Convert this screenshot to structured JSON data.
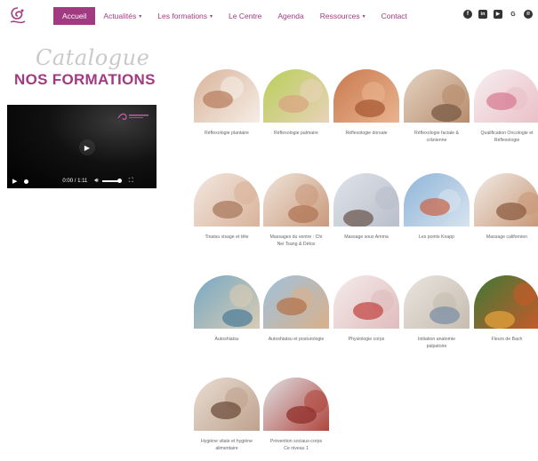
{
  "nav": {
    "items": [
      {
        "label": "Accueil",
        "active": true,
        "dropdown": false
      },
      {
        "label": "Actualités",
        "active": false,
        "dropdown": true
      },
      {
        "label": "Les formations",
        "active": false,
        "dropdown": true
      },
      {
        "label": "Le Centre",
        "active": false,
        "dropdown": false
      },
      {
        "label": "Agenda",
        "active": false,
        "dropdown": false
      },
      {
        "label": "Ressources",
        "active": false,
        "dropdown": true
      },
      {
        "label": "Contact",
        "active": false,
        "dropdown": false
      }
    ],
    "caret": "▾"
  },
  "social": [
    {
      "icon": "facebook-icon",
      "glyph": "f"
    },
    {
      "icon": "linkedin-icon",
      "glyph": "in"
    },
    {
      "icon": "youtube-icon",
      "glyph": "▶"
    },
    {
      "icon": "google-icon",
      "glyph": "G"
    },
    {
      "icon": "pinterest-icon",
      "glyph": "℗"
    }
  ],
  "hero": {
    "script_title": "Catalogue",
    "title": "NOS FORMATIONS"
  },
  "video": {
    "time": "0:00 / 1:11"
  },
  "formations": [
    {
      "label": "Réflexologie plantaire",
      "bg": [
        "#d9b49a",
        "#f5ede6"
      ],
      "accent": "#b98062"
    },
    {
      "label": "Réflexologie palmaire",
      "bg": [
        "#b9cf58",
        "#e8d2b9"
      ],
      "accent": "#d8a582"
    },
    {
      "label": "Réflexologie dorsale",
      "bg": [
        "#c97a4f",
        "#e9b48f"
      ],
      "accent": "#a85a34"
    },
    {
      "label": "Réflexologie faciale & crânienne",
      "bg": [
        "#e4d4c4",
        "#b88c6c"
      ],
      "accent": "#7a5a44"
    },
    {
      "label": "Qualification Oncologie et Réflexologie",
      "bg": [
        "#f7eef0",
        "#e9c0c8"
      ],
      "accent": "#d77e93"
    },
    {
      "label": "Tinatsu visage et tête",
      "bg": [
        "#f2e7e0",
        "#d9b39a"
      ],
      "accent": "#a87a5e"
    },
    {
      "label": "Massages du ventre : Chi Nei Tsang & Détox",
      "bg": [
        "#f0e4da",
        "#c99a7c"
      ],
      "accent": "#b07556"
    },
    {
      "label": "Massage sous Amma",
      "bg": [
        "#dfe3ea",
        "#b9bfcb"
      ],
      "accent": "#6d5a52"
    },
    {
      "label": "Les points Knapp",
      "bg": [
        "#8fb5d8",
        "#d7e3ef"
      ],
      "accent": "#c86a4e"
    },
    {
      "label": "Massage californien",
      "bg": [
        "#f1ebe5",
        "#c89878"
      ],
      "accent": "#8e5e42"
    },
    {
      "label": "Autoshiatsu",
      "bg": [
        "#76a9c4",
        "#d9cbb4"
      ],
      "accent": "#4f7f9a"
    },
    {
      "label": "Autoshiatsu et posturologie",
      "bg": [
        "#9fc2dc",
        "#d9b08c"
      ],
      "accent": "#b4744c"
    },
    {
      "label": "Physiologie corps",
      "bg": [
        "#f4ecec",
        "#e0bcbc"
      ],
      "accent": "#c44848"
    },
    {
      "label": "Initiation anatomie palpatoire",
      "bg": [
        "#e9e4de",
        "#c7bdb1"
      ],
      "accent": "#7d8fa6"
    },
    {
      "label": "Fleurs de Bach",
      "bg": [
        "#3f7a36",
        "#c65a2a"
      ],
      "accent": "#e3a23a"
    },
    {
      "label": "Hygiène vitale et hygiène alimentaire",
      "bg": [
        "#e8ddd3",
        "#bfa28d"
      ],
      "accent": "#6e4e3c"
    },
    {
      "label": "Prévention sociaux-corps Ce niveau 1",
      "bg": [
        "#dfe2e6",
        "#b0463d"
      ],
      "accent": "#8f2f2b"
    }
  ]
}
